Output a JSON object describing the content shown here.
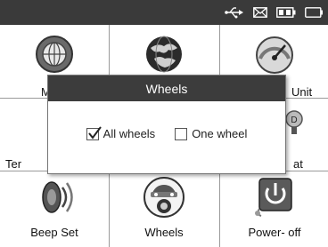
{
  "status_icons": [
    "usb-icon",
    "mail-icon",
    "battery-icon",
    "power-plug-icon"
  ],
  "menu": {
    "row1": {
      "left_label_visible": "M",
      "right_label_visible": "Unit"
    },
    "row2": {
      "left_label_visible": "Ter",
      "right_label_visible": "at"
    },
    "row3": [
      {
        "label": "Beep Set",
        "icon": "speaker-icon"
      },
      {
        "label": "Wheels",
        "icon": "wheels-icon"
      },
      {
        "label": "Power- off",
        "icon": "power-icon"
      }
    ]
  },
  "dialog": {
    "title": "Wheels",
    "options": [
      {
        "label": "All wheels",
        "checked": true
      },
      {
        "label": "One wheel",
        "checked": false
      }
    ]
  }
}
